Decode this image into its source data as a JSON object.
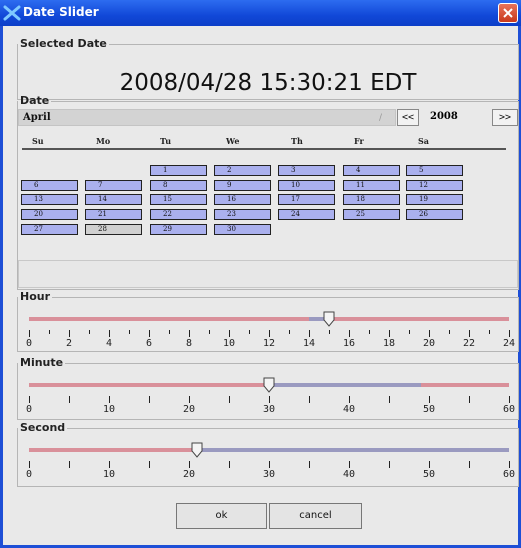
{
  "window": {
    "title": "Date Slider"
  },
  "selected": {
    "legend": "Selected Date",
    "value": "2008/04/28 15:30:21  EDT"
  },
  "date": {
    "legend": "Date",
    "month": "April",
    "prev_label": "<<",
    "year": "2008",
    "next_label": ">>",
    "weekdays": [
      "Su",
      "Mo",
      "Tu",
      "We",
      "Th",
      "Fr",
      "Sa"
    ],
    "weeks": [
      [
        "",
        "",
        "1",
        "2",
        "3",
        "4",
        "5"
      ],
      [
        "6",
        "7",
        "8",
        "9",
        "10",
        "11",
        "12"
      ],
      [
        "13",
        "14",
        "15",
        "16",
        "17",
        "18",
        "19"
      ],
      [
        "20",
        "21",
        "22",
        "23",
        "24",
        "25",
        "26"
      ],
      [
        "27",
        "28",
        "29",
        "30",
        "",
        "",
        ""
      ]
    ],
    "selected_day": "28"
  },
  "sliders": [
    {
      "key": "hour",
      "legend": "Hour",
      "min": 0,
      "max": 24,
      "value": 15,
      "major_labels": [
        "0",
        "2",
        "4",
        "6",
        "8",
        "10",
        "12",
        "14",
        "16",
        "18",
        "20",
        "22",
        "24"
      ],
      "minor_count": 24,
      "track_colors": [
        "#d9909a",
        "#9a9ac0"
      ],
      "highlight": [
        14,
        15
      ]
    },
    {
      "key": "minute",
      "legend": "Minute",
      "min": 0,
      "max": 60,
      "value": 30,
      "major_labels": [
        "0",
        "10",
        "20",
        "30",
        "40",
        "50",
        "60"
      ],
      "minor_count": 12,
      "track_colors": [
        "#d9909a",
        "#9a9ac0"
      ],
      "highlight": [
        30,
        49
      ]
    },
    {
      "key": "second",
      "legend": "Second",
      "min": 0,
      "max": 60,
      "value": 21,
      "major_labels": [
        "0",
        "10",
        "20",
        "30",
        "40",
        "50",
        "60"
      ],
      "minor_count": 12,
      "track_colors": [
        "#d9909a",
        "#9a9ac0"
      ],
      "highlight": [
        21,
        60
      ]
    }
  ],
  "buttons": {
    "ok": "ok",
    "cancel": "cancel"
  },
  "colors": {
    "titlebar": "#1148d8",
    "panel": "#e9e9e9",
    "day_cell": "#aab0ee",
    "track_pink": "#d9909a",
    "track_blue": "#9a9ac0"
  }
}
